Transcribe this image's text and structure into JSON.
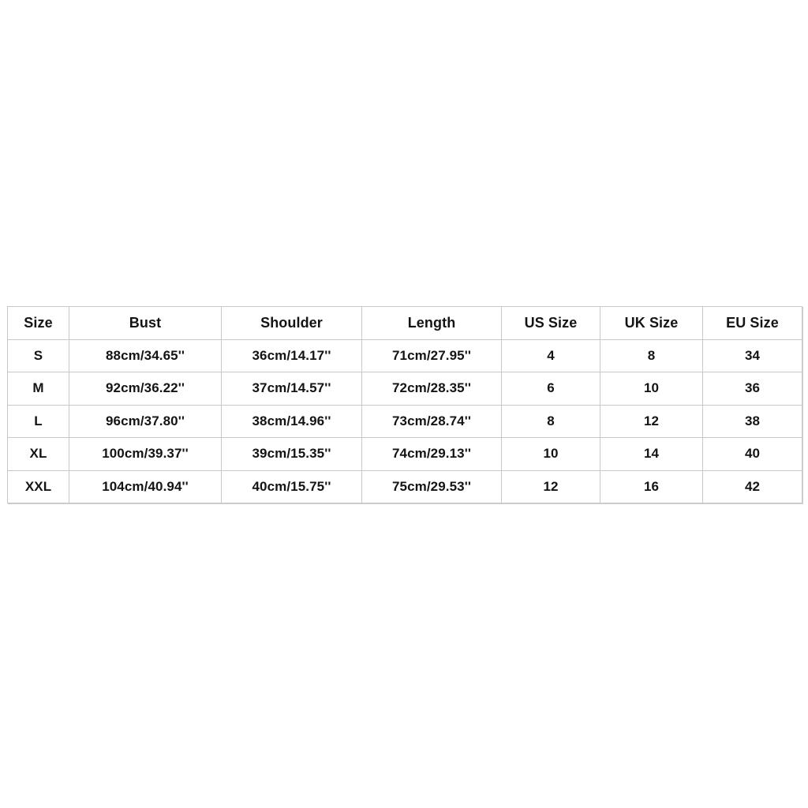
{
  "size_chart": {
    "headers": [
      "Size",
      "Bust",
      "Shoulder",
      "Length",
      "US Size",
      "UK Size",
      "EU Size"
    ],
    "rows": [
      [
        "S",
        "88cm/34.65''",
        "36cm/14.17''",
        "71cm/27.95''",
        "4",
        "8",
        "34"
      ],
      [
        "M",
        "92cm/36.22''",
        "37cm/14.57''",
        "72cm/28.35''",
        "6",
        "10",
        "36"
      ],
      [
        "L",
        "96cm/37.80''",
        "38cm/14.96''",
        "73cm/28.74''",
        "8",
        "12",
        "38"
      ],
      [
        "XL",
        "100cm/39.37''",
        "39cm/15.35''",
        "74cm/29.13''",
        "10",
        "14",
        "40"
      ],
      [
        "XXL",
        "104cm/40.94''",
        "40cm/15.75''",
        "75cm/29.53''",
        "12",
        "16",
        "42"
      ]
    ]
  }
}
